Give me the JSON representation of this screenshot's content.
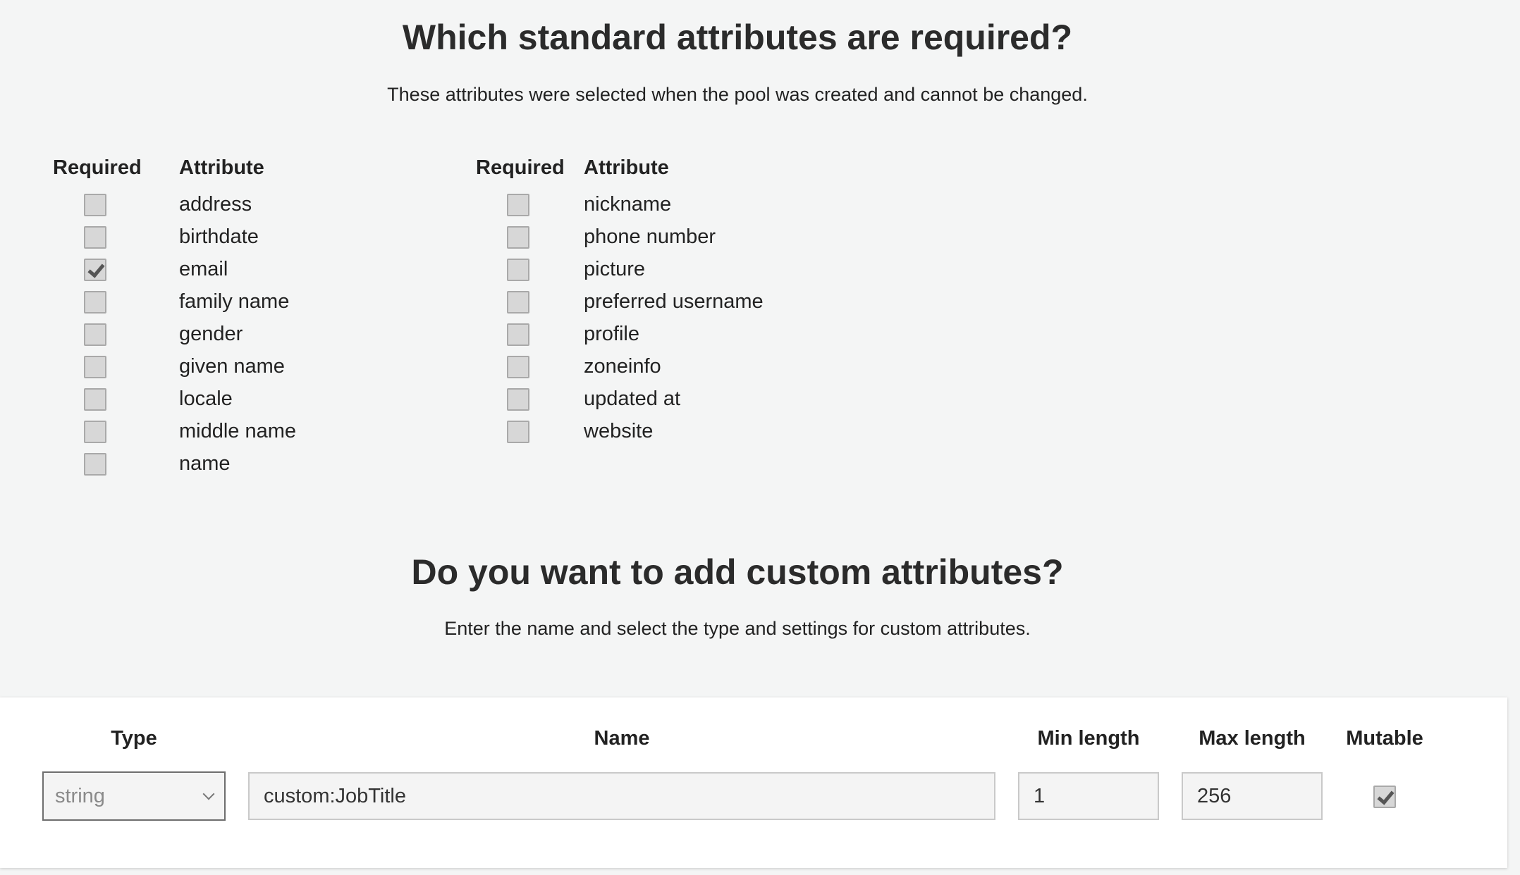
{
  "standard": {
    "title": "Which standard attributes are required?",
    "description": "These attributes were selected when the pool was created and cannot be changed.",
    "required_header": "Required",
    "attribute_header": "Attribute",
    "left_items": [
      {
        "label": "address",
        "checked": false
      },
      {
        "label": "birthdate",
        "checked": false
      },
      {
        "label": "email",
        "checked": true
      },
      {
        "label": "family name",
        "checked": false
      },
      {
        "label": "gender",
        "checked": false
      },
      {
        "label": "given name",
        "checked": false
      },
      {
        "label": "locale",
        "checked": false
      },
      {
        "label": "middle name",
        "checked": false
      },
      {
        "label": "name",
        "checked": false
      }
    ],
    "right_items": [
      {
        "label": "nickname",
        "checked": false
      },
      {
        "label": "phone number",
        "checked": false
      },
      {
        "label": "picture",
        "checked": false
      },
      {
        "label": "preferred username",
        "checked": false
      },
      {
        "label": "profile",
        "checked": false
      },
      {
        "label": "zoneinfo",
        "checked": false
      },
      {
        "label": "updated at",
        "checked": false
      },
      {
        "label": "website",
        "checked": false
      }
    ]
  },
  "custom": {
    "title": "Do you want to add custom attributes?",
    "description": "Enter the name and select the type and settings for custom attributes.",
    "headers": {
      "type": "Type",
      "name": "Name",
      "min_length": "Min length",
      "max_length": "Max length",
      "mutable": "Mutable"
    },
    "row": {
      "type": "string",
      "name": "custom:JobTitle",
      "min_length": "1",
      "max_length": "256",
      "mutable": true
    }
  }
}
